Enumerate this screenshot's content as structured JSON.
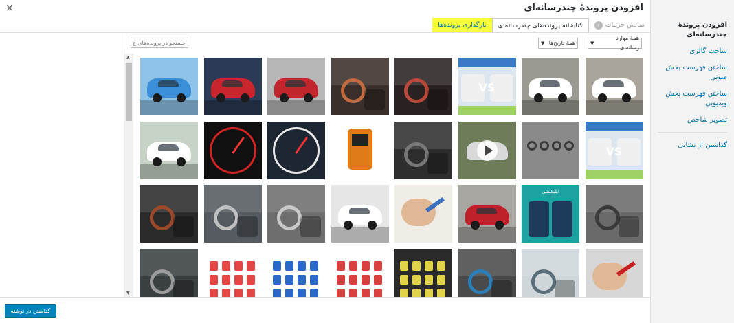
{
  "modal": {
    "title": "افزودن پروندهٔ چندرسانه‌ای",
    "close_glyph": "×"
  },
  "sidebar": {
    "items": [
      {
        "label": "افزودن پروندهٔ چندرسانه‌ای"
      },
      {
        "label": "ساخت گالری"
      },
      {
        "label": "ساختن فهرست پخش صوتی"
      },
      {
        "label": "ساختن فهرست پخش ویدیویی"
      },
      {
        "label": "تصویر شاخص"
      },
      {
        "label": "گذاشتن از نشانی"
      }
    ]
  },
  "tabs": {
    "upload": "بارگذاری پرونده‌ها",
    "library": "کتابخانه پرونده‌های چندرسانه‌ای",
    "details": "نمایش جزئیات"
  },
  "toolbar": {
    "filter_type": "همهٔ موارد رسانه‌ای",
    "filter_date": "همهٔ تاریخ‌ها",
    "search_placeholder": "جستجو در پرونده‌های چ"
  },
  "tiles": [
    {
      "bg": "#8fc3e8",
      "accent": "#3b8fd8",
      "kind": "car"
    },
    {
      "bg": "#2b3a55",
      "accent": "#c8262c",
      "kind": "car"
    },
    {
      "bg": "#b7b7b7",
      "accent": "#c1272d",
      "kind": "car"
    },
    {
      "bg": "#3a2f2a",
      "accent": "#c06a3f",
      "kind": "interior"
    },
    {
      "bg": "#2a2222",
      "accent": "#b8483a",
      "kind": "interior"
    },
    {
      "bg": "#dbe6ee",
      "accent": "#5a8bd0",
      "kind": "vs",
      "label": "VS"
    },
    {
      "bg": "#9a9a92",
      "accent": "#ffffff",
      "kind": "car"
    },
    {
      "bg": "#a9a59a",
      "accent": "#ffffff",
      "kind": "car"
    },
    {
      "bg": "#c7d3c6",
      "accent": "#ffffff",
      "kind": "car"
    },
    {
      "bg": "#101010",
      "accent": "#d22222",
      "kind": "gauge"
    },
    {
      "bg": "#1d2733",
      "accent": "#e8e8e8",
      "kind": "gauge"
    },
    {
      "bg": "#ffffff",
      "accent": "#e07b1a",
      "kind": "obd"
    },
    {
      "bg": "#2e2e2e",
      "accent": "#777777",
      "kind": "interior"
    },
    {
      "bg": "#6f7c5a",
      "accent": "#d9d9d9",
      "kind": "video"
    },
    {
      "bg": "#8a8a8a",
      "accent": "#3a3a3a",
      "kind": "engine"
    },
    {
      "bg": "#dbe6ee",
      "accent": "#5a8bd0",
      "kind": "vs",
      "label": "VS"
    },
    {
      "bg": "#2a2a2a",
      "accent": "#9a4a2a",
      "kind": "interior"
    },
    {
      "bg": "#555b60",
      "accent": "#c0c0c0",
      "kind": "interior"
    },
    {
      "bg": "#6e6e6e",
      "accent": "#c8c8c8",
      "kind": "interior"
    },
    {
      "bg": "#e6e6e6",
      "accent": "#ffffff",
      "kind": "car"
    },
    {
      "bg": "#f0ede6",
      "accent": "#3a6fbf",
      "kind": "hand"
    },
    {
      "bg": "#a7a6a0",
      "accent": "#c0202a",
      "kind": "car"
    },
    {
      "bg": "#1aa3a0",
      "accent": "#1d3b5a",
      "kind": "poster",
      "label": "اپلیکیشن"
    },
    {
      "bg": "#6a6a6a",
      "accent": "#3a3a3a",
      "kind": "interior"
    },
    {
      "bg": "#3a3f42",
      "accent": "#9a9a9a",
      "kind": "interior"
    },
    {
      "bg": "#ffffff",
      "accent": "#e44545",
      "kind": "fuses"
    },
    {
      "bg": "#ffffff",
      "accent": "#2a69c9",
      "kind": "fuses"
    },
    {
      "bg": "#ffffff",
      "accent": "#d94040",
      "kind": "fuses"
    },
    {
      "bg": "#2a2a2a",
      "accent": "#e0d34a",
      "kind": "fuses"
    },
    {
      "bg": "#4a4a4a",
      "accent": "#2b7fb8",
      "kind": "interior"
    },
    {
      "bg": "#cfd6da",
      "accent": "#5a6f7a",
      "kind": "interior"
    },
    {
      "bg": "#d7d7d7",
      "accent": "#c82020",
      "kind": "hand"
    }
  ],
  "footer": {
    "insert_label": "گذاشتن در نوشته"
  },
  "scroll": {
    "up_glyph": "▲",
    "down_glyph": "▼"
  }
}
